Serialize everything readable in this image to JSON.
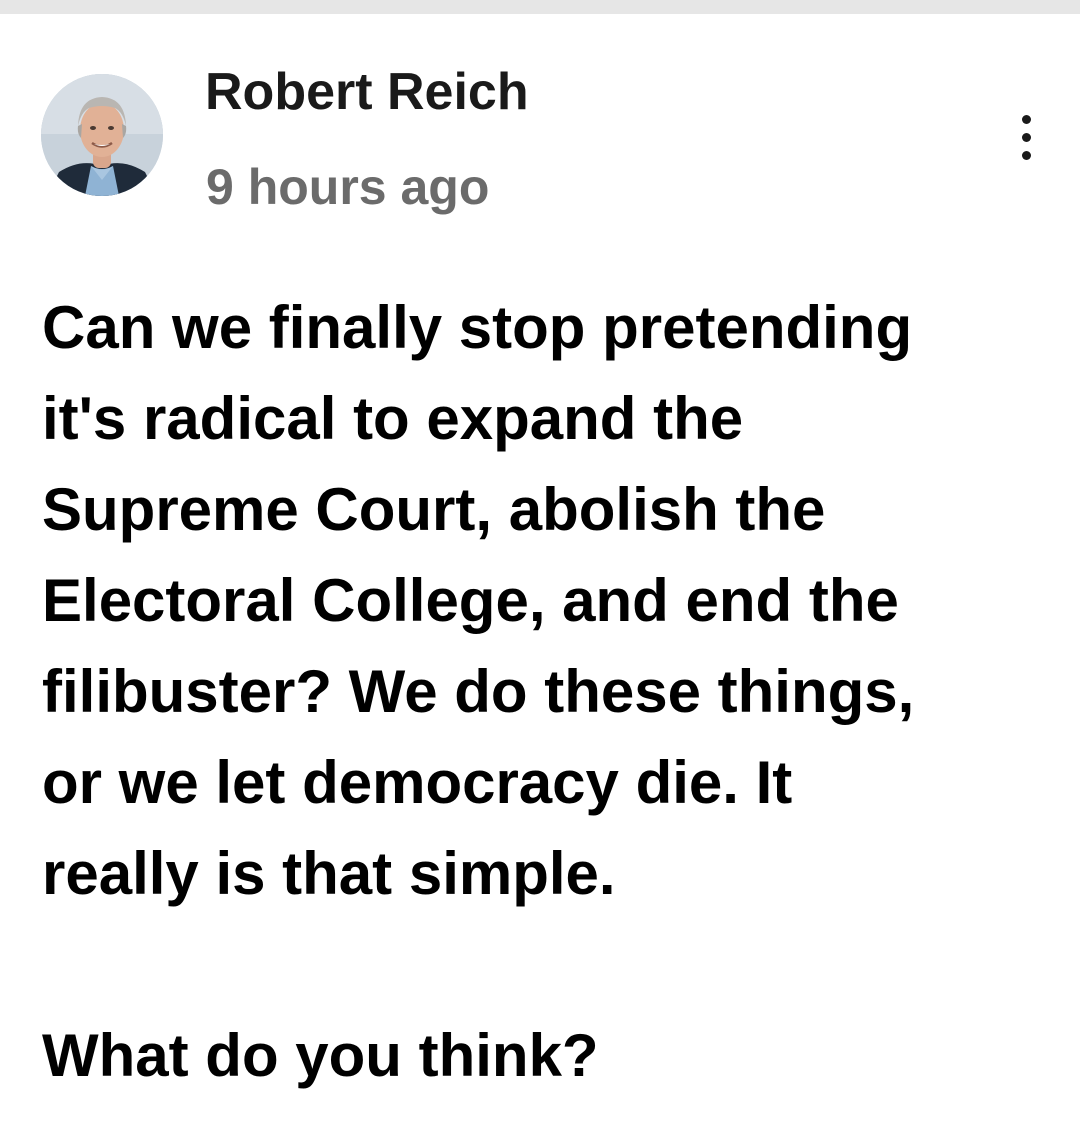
{
  "post": {
    "author_name": "Robert Reich",
    "time_ago": "9 hours ago",
    "body_paragraph": "Can we finally stop pretending\nit's radical to expand the\nSupreme Court, abolish the\nElectoral College, and end the\nfilibuster? We do these things,\nor we let democracy die. It\nreally is that simple.",
    "body_question": "What do you think?"
  },
  "icons": {
    "more": "more-vertical-icon",
    "avatar": "profile-photo"
  },
  "colors": {
    "background": "#ffffff",
    "top_strip": "#e6e6e6",
    "author_text": "#1a1a1a",
    "timestamp_text": "#6b6b6b",
    "body_text": "#000000"
  }
}
